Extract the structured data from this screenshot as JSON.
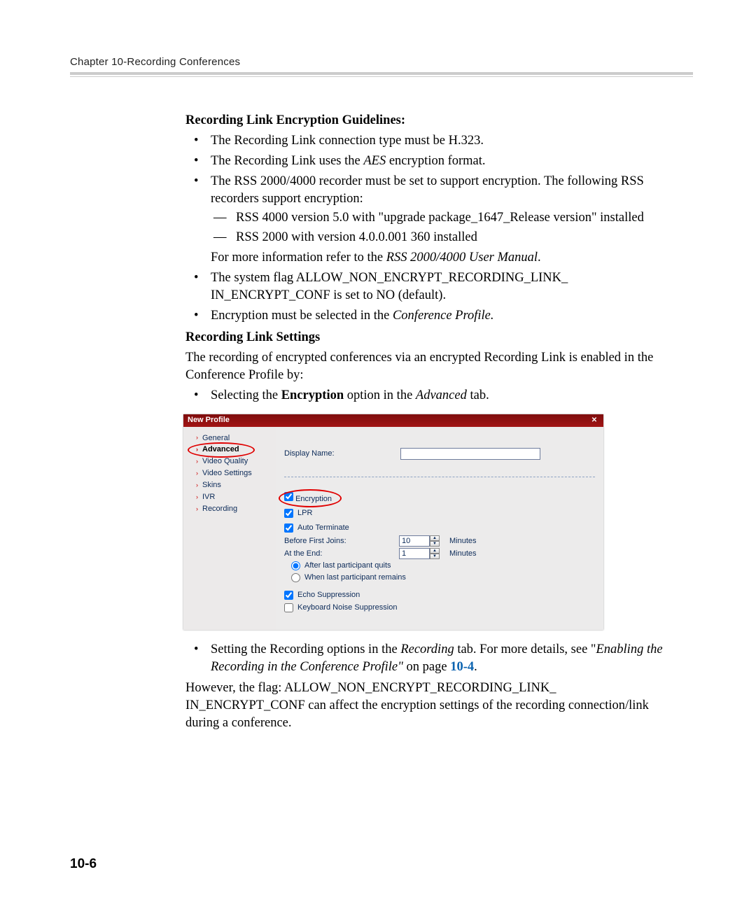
{
  "header": {
    "chapter": "Chapter 10-Recording Conferences"
  },
  "section1": {
    "heading": "Recording Link Encryption Guidelines:",
    "b1": "The Recording Link connection type must be H.323.",
    "b2_pre": "The Recording Link uses the ",
    "b2_em": "AES",
    "b2_post": " encryption format.",
    "b3": "The RSS 2000/4000 recorder must be set to support encryption. The following RSS recorders support encryption:",
    "d1": "RSS 4000 version 5.0 with \"upgrade package_1647_Release version\" installed",
    "d2": "RSS 2000 with version 4.0.0.001 360 installed",
    "b3_tail_pre": "For more information refer to the ",
    "b3_tail_em": "RSS 2000/4000 User Manual",
    "b3_tail_post": ".",
    "b4": "The system flag ALLOW_NON_ENCRYPT_RECORDING_LINK_ IN_ENCRYPT_CONF is set to NO (default).",
    "b5_pre": "Encryption must be selected in the ",
    "b5_em": "Conference Profile."
  },
  "section2": {
    "heading": "Recording Link Settings",
    "intro": "The recording of encrypted conferences via an encrypted Recording Link is enabled in the Conference Profile by:",
    "b1_pre": "Selecting the ",
    "b1_bold": "Encryption",
    "b1_mid": " option in the ",
    "b1_em": "Advanced",
    "b1_post": " tab."
  },
  "screenshot": {
    "title": "New Profile",
    "nav": {
      "general": "General",
      "advanced": "Advanced",
      "video_quality": "Video Quality",
      "video_settings": "Video Settings",
      "skins": "Skins",
      "ivr": "IVR",
      "recording": "Recording"
    },
    "panel": {
      "display_name_label": "Display Name:",
      "display_name_value": "",
      "encryption": "Encryption",
      "lpr": "LPR",
      "auto_terminate": "Auto Terminate",
      "before_first_joins": "Before First Joins:",
      "before_value": "10",
      "at_the_end": "At the End:",
      "end_value": "1",
      "minutes": "Minutes",
      "radio_quit": "After last participant quits",
      "radio_remain": "When last participant remains",
      "echo": "Echo Suppression",
      "keyboard": "Keyboard Noise Suppression"
    }
  },
  "section3": {
    "b2_pre": "Setting the Recording options in the ",
    "b2_em1": "Recording",
    "b2_mid": " tab. For more details, see \"",
    "b2_em2": "Enabling the Recording in the Conference Profile\"",
    "b2_onpage": " on page ",
    "b2_ref": "10-4",
    "b2_post": ".",
    "tail": "However, the flag: ALLOW_NON_ENCRYPT_RECORDING_LINK_ IN_ENCRYPT_CONF can affect the encryption settings of the recording connection/link during a conference."
  },
  "page_number": "10-6"
}
